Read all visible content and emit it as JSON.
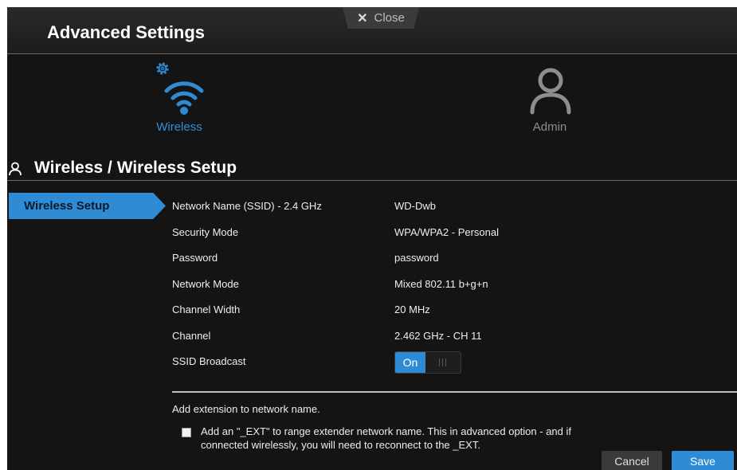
{
  "window": {
    "title": "Advanced Settings",
    "close_label": "Close"
  },
  "nav": [
    {
      "label": "Wireless",
      "icon": "wifi-icon",
      "active": true
    },
    {
      "label": "Admin",
      "icon": "user-icon",
      "active": false
    }
  ],
  "section": {
    "title": "Wireless / Wireless Setup"
  },
  "sidebar": {
    "items": [
      {
        "label": "Wireless Setup",
        "active": true
      }
    ]
  },
  "settings": [
    {
      "label": "Network Name (SSID) - 2.4 GHz",
      "value": "WD-Dwb"
    },
    {
      "label": "Security Mode",
      "value": "WPA/WPA2 - Personal"
    },
    {
      "label": "Password",
      "value": "password"
    },
    {
      "label": "Network Mode",
      "value": "Mixed 802.11 b+g+n"
    },
    {
      "label": "Channel Width",
      "value": "20 MHz"
    },
    {
      "label": "Channel",
      "value": "2.462 GHz - CH 11"
    },
    {
      "label": "SSID Broadcast",
      "toggle": "On"
    }
  ],
  "extension": {
    "heading": "Add extension to network name.",
    "checkbox_checked": false,
    "description": "Add an \"_EXT\" to range extender network name. This in advanced option - and if connected wirelessly, you will need to reconnect to the _EXT."
  },
  "buttons": {
    "cancel": "Cancel",
    "save": "Save"
  },
  "colors": {
    "accent": "#2f8cd4",
    "background": "#141414",
    "inactive": "#8d8d8d"
  }
}
